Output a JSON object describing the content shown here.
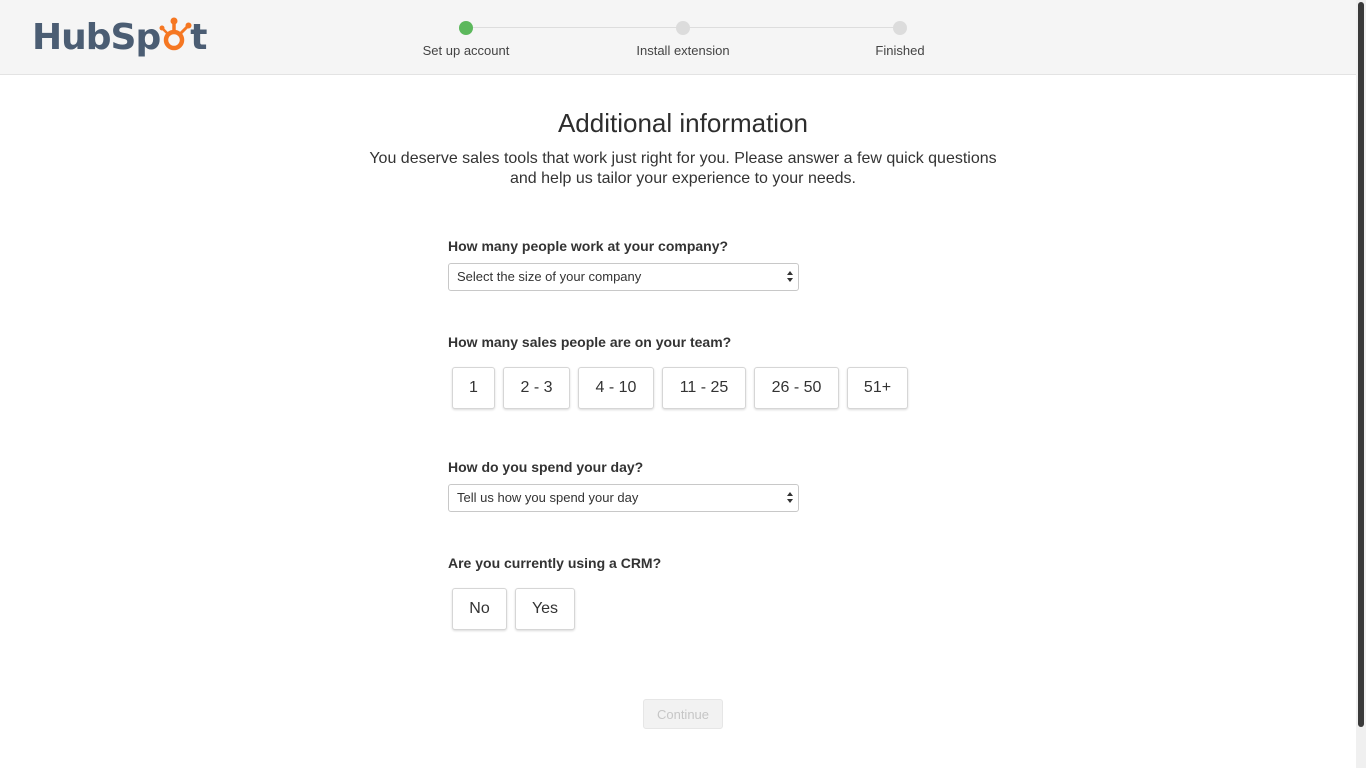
{
  "header": {
    "logo_text_left": "HubSp",
    "logo_text_right": "t",
    "steps": [
      {
        "label": "Set up account",
        "active": true
      },
      {
        "label": "Install extension",
        "active": false
      },
      {
        "label": "Finished",
        "active": false
      }
    ]
  },
  "main": {
    "title": "Additional information",
    "subtitle": "You deserve sales tools that work just right for you. Please answer a few quick questions and help us tailor your experience to your needs.",
    "questions": {
      "company_size": {
        "label": "How many people work at your company?",
        "selected": "Select the size of your company"
      },
      "sales_team": {
        "label": "How many sales people are on your team?",
        "options": [
          "1",
          "2 - 3",
          "4 - 10",
          "11 - 25",
          "26 - 50",
          "51+"
        ]
      },
      "day": {
        "label": "How do you spend your day?",
        "selected": "Tell us how you spend your day"
      },
      "crm": {
        "label": "Are you currently using a CRM?",
        "options": [
          "No",
          "Yes"
        ]
      }
    },
    "continue_label": "Continue"
  },
  "colors": {
    "accent_orange": "#f57722",
    "step_active": "#5cb85c",
    "step_inactive": "#dcdcdc",
    "logo_gray": "#4b5d73"
  }
}
